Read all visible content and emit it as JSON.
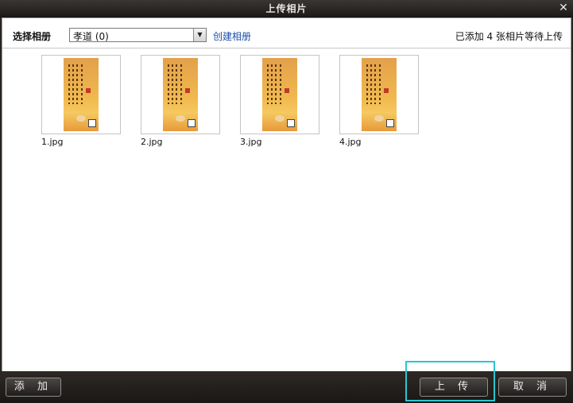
{
  "window": {
    "title": "上传相片"
  },
  "toolbar": {
    "album_label": "选择相册",
    "album_selected": "孝道 (0)",
    "create_album": "创建相册",
    "status": "已添加 4 张相片等待上传"
  },
  "photos": [
    {
      "name": "1.jpg"
    },
    {
      "name": "2.jpg"
    },
    {
      "name": "3.jpg"
    },
    {
      "name": "4.jpg"
    }
  ],
  "buttons": {
    "add": "添 加",
    "upload": "上 传",
    "cancel": "取 消"
  },
  "icons": {
    "close": "close-icon",
    "dropdown": "chevron-down-icon"
  },
  "colors": {
    "highlight": "#2ac6d0",
    "link": "#1a4fa8"
  }
}
